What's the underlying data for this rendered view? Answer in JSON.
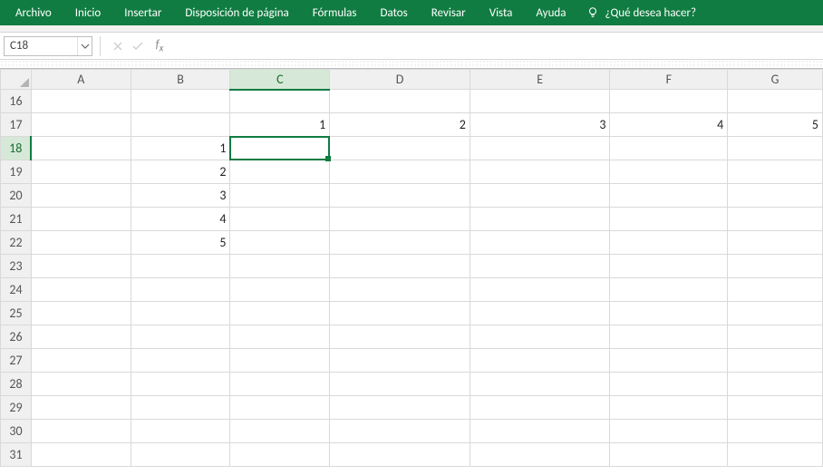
{
  "ribbon": {
    "tabs": [
      "Archivo",
      "Inicio",
      "Insertar",
      "Disposición de página",
      "Fórmulas",
      "Datos",
      "Revisar",
      "Vista",
      "Ayuda"
    ],
    "tell_me_placeholder": "¿Qué desea hacer?"
  },
  "namebox": {
    "value": "C18"
  },
  "formula_bar": {
    "value": ""
  },
  "columns": [
    {
      "letter": "A",
      "width": 110
    },
    {
      "letter": "B",
      "width": 110
    },
    {
      "letter": "C",
      "width": 110
    },
    {
      "letter": "D",
      "width": 155
    },
    {
      "letter": "E",
      "width": 155
    },
    {
      "letter": "F",
      "width": 130
    },
    {
      "letter": "G",
      "width": 105
    }
  ],
  "rows": [
    16,
    17,
    18,
    19,
    20,
    21,
    22,
    23,
    24,
    25,
    26,
    27,
    28,
    29,
    30,
    31
  ],
  "active_cell": {
    "col": "C",
    "row": 18
  },
  "cells": {
    "C17": "1",
    "D17": "2",
    "E17": "3",
    "F17": "4",
    "G17": "5",
    "B18": "1",
    "B19": "2",
    "B20": "3",
    "B21": "4",
    "B22": "5"
  }
}
